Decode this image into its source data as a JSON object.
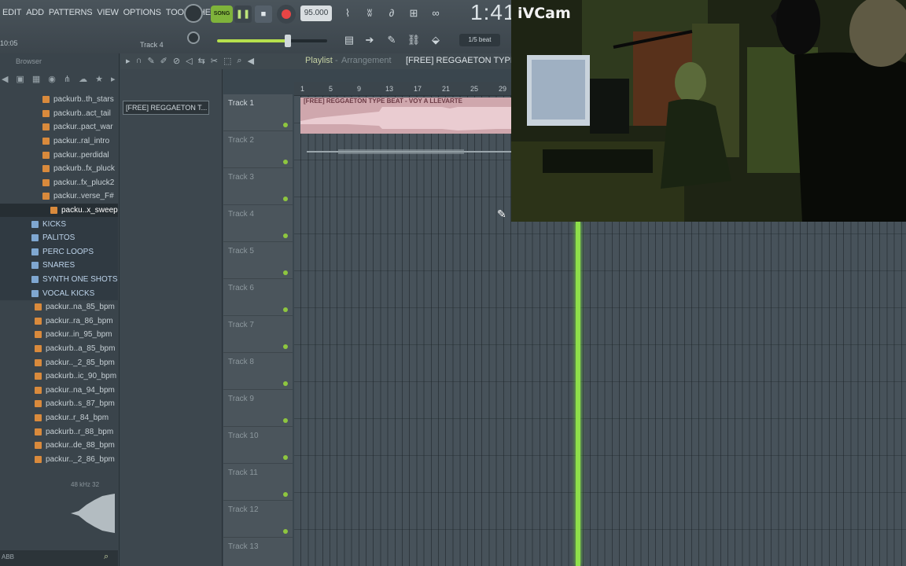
{
  "menu": [
    "EDIT",
    "ADD",
    "PATTERNS",
    "VIEW",
    "OPTIONS",
    "TOOLS",
    "HELP"
  ],
  "hint": "10:05",
  "track_hint": "Track 4",
  "transport": {
    "song_label": "SONG",
    "tempo": "95.000",
    "time": "1:41:"
  },
  "snap": "1/5 beat",
  "browser": {
    "title": "Browser",
    "items": [
      {
        "label": "packurb..th_stars",
        "kind": "file"
      },
      {
        "label": "packurb..act_tail",
        "kind": "file"
      },
      {
        "label": "packur..pact_war",
        "kind": "file"
      },
      {
        "label": "packur..ral_intro",
        "kind": "file"
      },
      {
        "label": "packur..perdidal",
        "kind": "file"
      },
      {
        "label": "packurb..fx_pluck",
        "kind": "file"
      },
      {
        "label": "packur..fx_pluck2",
        "kind": "file"
      },
      {
        "label": "packur..verse_F#",
        "kind": "file"
      },
      {
        "label": "packu..x_sweep",
        "kind": "file",
        "selected": true
      },
      {
        "label": "KICKS",
        "kind": "folder"
      },
      {
        "label": "PALITOS",
        "kind": "folder"
      },
      {
        "label": "PERC LOOPS",
        "kind": "folder"
      },
      {
        "label": "SNARES",
        "kind": "folder"
      },
      {
        "label": "SYNTH ONE SHOTS",
        "kind": "folder"
      },
      {
        "label": "VOCAL KICKS",
        "kind": "folder"
      },
      {
        "label": "packur..na_85_bpm",
        "kind": "file"
      },
      {
        "label": "packur..ra_86_bpm",
        "kind": "file"
      },
      {
        "label": "packur..in_95_bpm",
        "kind": "file"
      },
      {
        "label": "packurb..a_85_bpm",
        "kind": "file"
      },
      {
        "label": "packur.._2_85_bpm",
        "kind": "file"
      },
      {
        "label": "packurb..ic_90_bpm",
        "kind": "file"
      },
      {
        "label": "packur..na_94_bpm",
        "kind": "file"
      },
      {
        "label": "packurb..s_87_bpm",
        "kind": "file"
      },
      {
        "label": "packur..r_84_bpm",
        "kind": "file"
      },
      {
        "label": "packurb..r_88_bpm",
        "kind": "file"
      },
      {
        "label": "packur..de_88_bpm",
        "kind": "file"
      },
      {
        "label": "packur.._2_86_bpm",
        "kind": "file"
      }
    ],
    "sample_info": "48 kHz 32",
    "bottom_label": "ABB"
  },
  "pattern_item": "[FREE] REGGAETON T...",
  "playlist": {
    "label": "Playlist",
    "arrangement": "Arrangement",
    "project": "[FREE] REGGAETON TYPE",
    "clip_title": "[FREE] REGGAETON TYPE BEAT - VOY A LLEVARTE",
    "bars": [
      "1",
      "5",
      "9",
      "13",
      "17",
      "21",
      "25",
      "29"
    ],
    "tracks": [
      "Track 1",
      "Track 2",
      "Track 3",
      "Track 4",
      "Track 5",
      "Track 6",
      "Track 7",
      "Track 8",
      "Track 9",
      "Track 10",
      "Track 11",
      "Track 12",
      "Track 13"
    ]
  },
  "webcam": {
    "label": "iVCam"
  },
  "colors": {
    "accent_green": "#8ee04a",
    "record_red": "#e84545",
    "clip_pink": "#cfa7ad",
    "file_orange": "#d98a3c"
  }
}
